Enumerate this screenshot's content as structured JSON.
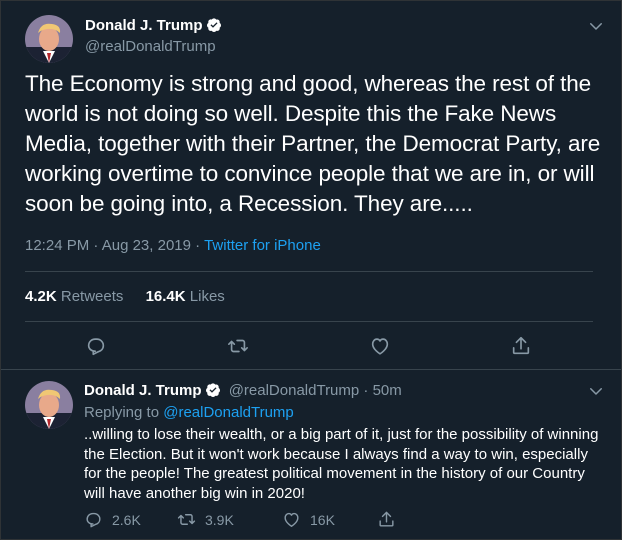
{
  "main_tweet": {
    "display_name": "Donald J. Trump",
    "handle": "@realDonaldTrump",
    "text": "The Economy is strong and good, whereas the rest of the world is not doing so well. Despite this the Fake News Media, together with their Partner, the Democrat Party, are working overtime to convince people that we are in, or will soon be going into, a Recession. They are.....",
    "time": "12:24 PM",
    "date": "Aug 23, 2019",
    "source": "Twitter for iPhone",
    "retweets_count": "4.2K",
    "retweets_label": "Retweets",
    "likes_count": "16.4K",
    "likes_label": "Likes"
  },
  "reply_tweet": {
    "display_name": "Donald J. Trump",
    "handle": "@realDonaldTrump",
    "age": "50m",
    "replying_to_label": "Replying to",
    "replying_to_handle": "@realDonaldTrump",
    "text": "..willing to lose their wealth, or a big part of it, just for the possibility of winning the Election. But it won't work because I always find a way to win, especially for the people! The greatest political movement in the history of our Country will have another big win in 2020!",
    "reply_count": "2.6K",
    "retweet_count": "3.9K",
    "like_count": "16K"
  },
  "colors": {
    "background": "#15202b",
    "primary_text": "#ffffff",
    "secondary_text": "#8899a6",
    "accent": "#1da1f2",
    "divider": "#38444d"
  },
  "icons": {
    "verified": "verified-badge-icon",
    "more": "chevron-down-icon",
    "reply": "reply-icon",
    "retweet": "retweet-icon",
    "like": "heart-icon",
    "share": "share-icon"
  },
  "separators": {
    "dot": "·"
  }
}
